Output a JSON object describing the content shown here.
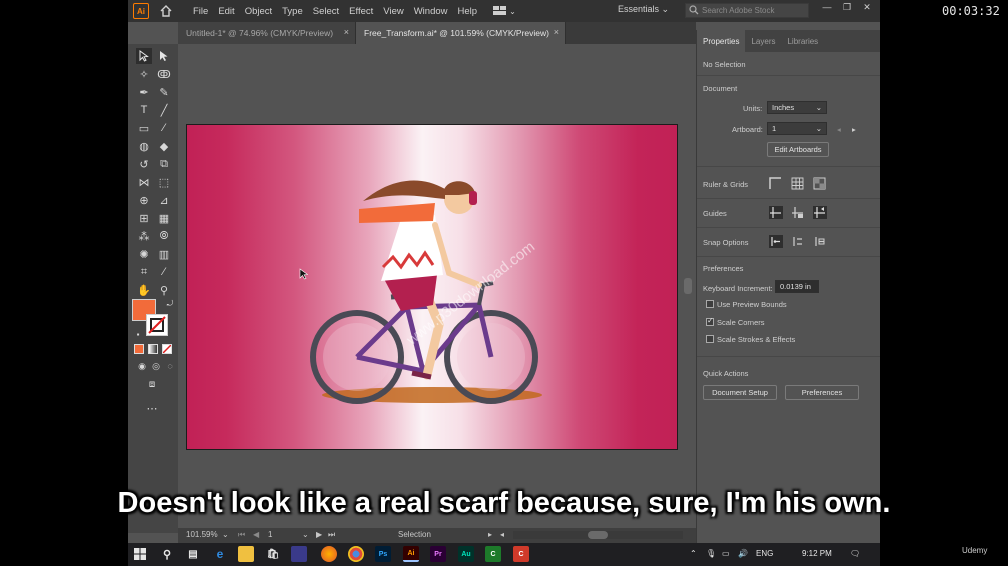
{
  "video": {
    "timer": "00:03:32",
    "subtitle": "Doesn't look like a real scarf because, sure, I'm his own.",
    "brand": "Udemy"
  },
  "app": {
    "logo": "Ai",
    "menu": [
      "File",
      "Edit",
      "Object",
      "Type",
      "Select",
      "Effect",
      "View",
      "Window",
      "Help"
    ],
    "workspace": "Essentials",
    "search_placeholder": "Search Adobe Stock",
    "window_buttons": [
      "—",
      "❐",
      "✕"
    ]
  },
  "tabs": [
    {
      "label": "Untitled-1* @ 74.96% (CMYK/Preview)",
      "close": "×",
      "active": false
    },
    {
      "label": "Free_Transform.ai* @ 101.59% (CMYK/Preview)",
      "close": "×",
      "active": true
    }
  ],
  "canvas": {
    "watermark": "www.p30download.com"
  },
  "status": {
    "zoom": "101.59%",
    "artboard_num": "1",
    "tool": "Selection"
  },
  "panel": {
    "tabs": [
      "Properties",
      "Layers",
      "Libraries"
    ],
    "no_selection": "No Selection",
    "document_header": "Document",
    "units_label": "Units:",
    "units_value": "Inches",
    "artboard_label": "Artboard:",
    "artboard_value": "1",
    "edit_artboards": "Edit Artboards",
    "ruler_grids": "Ruler & Grids",
    "guides": "Guides",
    "snap_options": "Snap Options",
    "preferences_header": "Preferences",
    "keyboard_increment_label": "Keyboard Increment:",
    "keyboard_increment_value": "0.0139 in",
    "use_preview_bounds": "Use Preview Bounds",
    "scale_corners": "Scale Corners",
    "scale_strokes": "Scale Strokes & Effects",
    "quick_actions": "Quick Actions",
    "document_setup": "Document Setup",
    "preferences_button": "Preferences"
  },
  "checkboxes": {
    "use_preview_bounds": false,
    "scale_corners": true,
    "scale_strokes": false
  },
  "colors": {
    "fill": "#f26b3a",
    "accent": "#ff7c00",
    "artboard_edge": "#c12156"
  },
  "taskbar": {
    "apps": [
      "Ps",
      "Ai",
      "Pr",
      "Au",
      "C",
      "C"
    ],
    "language": "ENG",
    "time": "9:12 PM"
  }
}
